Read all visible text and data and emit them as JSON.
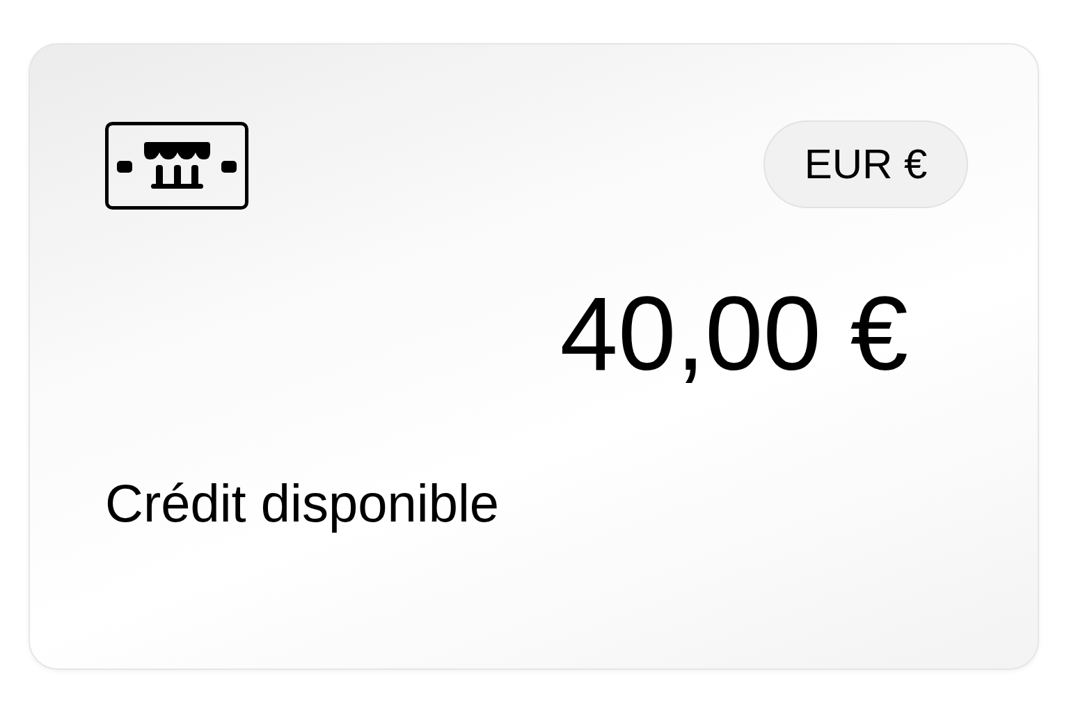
{
  "card": {
    "currency_badge": "EUR €",
    "amount": "40,00 €",
    "label": "Crédit disponible"
  }
}
